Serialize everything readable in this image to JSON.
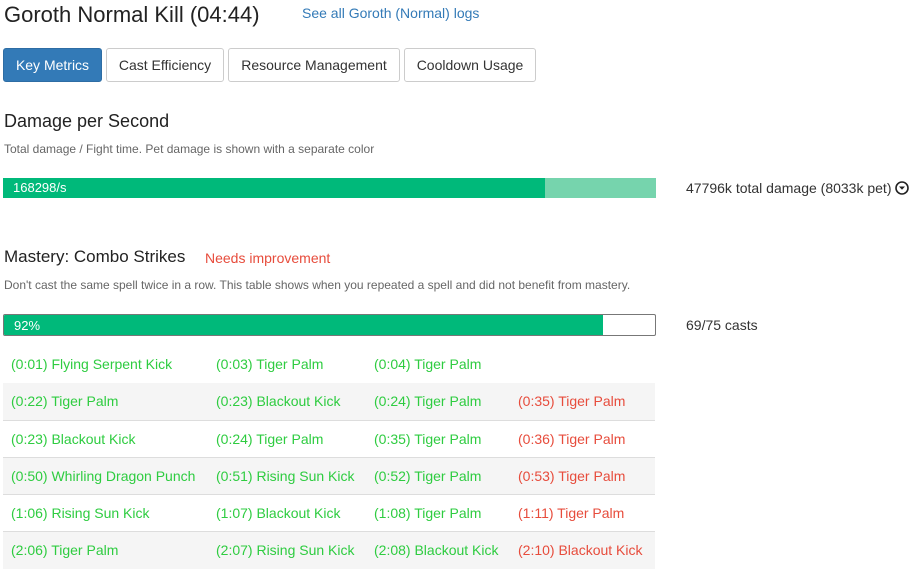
{
  "header": {
    "title": "Goroth Normal Kill (04:44)",
    "logs_link": "See all Goroth (Normal) logs"
  },
  "tabs": [
    {
      "label": "Key Metrics",
      "active": true
    },
    {
      "label": "Cast Efficiency",
      "active": false
    },
    {
      "label": "Resource Management",
      "active": false
    },
    {
      "label": "Cooldown Usage",
      "active": false
    }
  ],
  "dps": {
    "title": "Damage per Second",
    "subtitle": "Total damage / Fight time. Pet damage is shown with a separate color",
    "value_label": "168298/s",
    "player_fraction": 0.83,
    "total_fraction": 1.0,
    "total_text": "47796k total damage (8033k pet)",
    "player_color": "#00b97a",
    "pet_color": "#76d4ad"
  },
  "mastery": {
    "title": "Mastery: Combo Strikes",
    "status": "Needs improvement",
    "subtitle": "Don't cast the same spell twice in a row. This table shows when you repeated a spell and did not benefit from mastery.",
    "percent_label": "92%",
    "fraction": 0.92,
    "casts_text": "69/75 casts",
    "bar_color": "#00b97a"
  },
  "cast_rows": [
    [
      "(0:01) Flying Serpent Kick",
      "(0:03) Tiger Palm",
      "(0:04) Tiger Palm",
      ""
    ],
    [
      "(0:22) Tiger Palm",
      "(0:23) Blackout Kick",
      "(0:24) Tiger Palm",
      "(0:35) Tiger Palm"
    ],
    [
      "(0:23) Blackout Kick",
      "(0:24) Tiger Palm",
      "(0:35) Tiger Palm",
      "(0:36) Tiger Palm"
    ],
    [
      "(0:50) Whirling Dragon Punch",
      "(0:51) Rising Sun Kick",
      "(0:52) Tiger Palm",
      "(0:53) Tiger Palm"
    ],
    [
      "(1:06) Rising Sun Kick",
      "(1:07) Blackout Kick",
      "(1:08) Tiger Palm",
      "(1:11) Tiger Palm"
    ],
    [
      "(2:06) Tiger Palm",
      "(2:07) Rising Sun Kick",
      "(2:08) Blackout Kick",
      "(2:10) Blackout Kick"
    ]
  ],
  "icons": {
    "expand": "chevron-down-circle-icon"
  }
}
